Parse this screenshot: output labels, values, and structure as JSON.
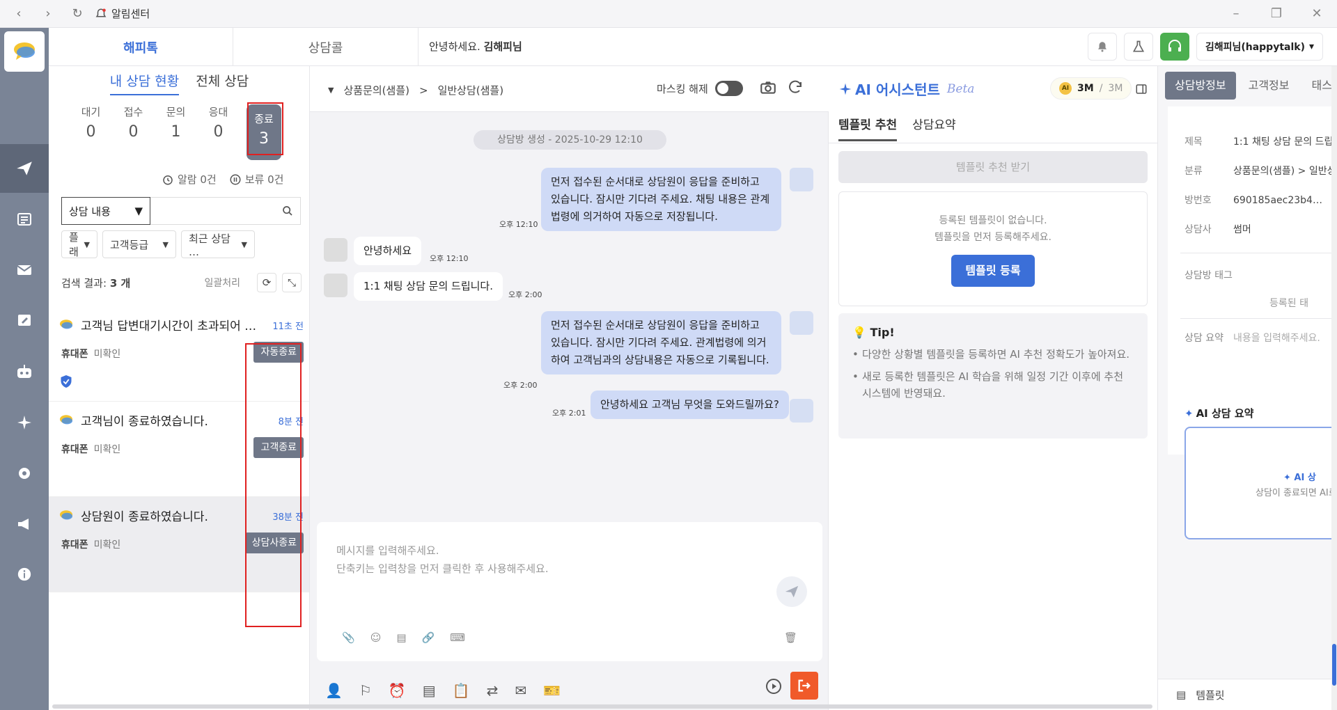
{
  "titlebar": {
    "app_name": "알림센터"
  },
  "topbar": {
    "tabs": [
      {
        "label": "해피톡"
      },
      {
        "label": "상담콜"
      }
    ],
    "greeting_prefix": "안녕하세요.",
    "greeting_name": "김해피님",
    "user_label": "김해피님(happytalk)"
  },
  "list": {
    "subtabs": [
      {
        "label": "내 상담 현황"
      },
      {
        "label": "전체 상담"
      }
    ],
    "counts": [
      {
        "label": "대기",
        "value": "0"
      },
      {
        "label": "접수",
        "value": "0"
      },
      {
        "label": "문의",
        "value": "1"
      },
      {
        "label": "응대",
        "value": "0"
      },
      {
        "label": "종료",
        "value": "3"
      }
    ],
    "alarm": "알람 0건",
    "hold": "보류 0건",
    "search_select": "상담 내용",
    "filters": [
      {
        "label": "플래"
      },
      {
        "label": "고객등급"
      },
      {
        "label": "최근 상담 …"
      }
    ],
    "result_prefix": "검색 결과:",
    "result_count": "3 개",
    "bulk_label": "일괄처리",
    "items": [
      {
        "title": "고객님 답변대기시간이 초과되어 …",
        "time": "11초 전",
        "channel": "휴대폰",
        "status": "미확인",
        "badge": "자동종료"
      },
      {
        "title": "고객님이 종료하였습니다.",
        "time": "8분 전",
        "channel": "휴대폰",
        "status": "미확인",
        "badge": "고객종료"
      },
      {
        "title": "상담원이 종료하였습니다.",
        "time": "38분 전",
        "channel": "휴대폰",
        "status": "미확인",
        "badge": "상담사종료"
      }
    ]
  },
  "chat": {
    "breadcrumb": [
      "상품문의(샘플)",
      ">",
      "일반상담(샘플)"
    ],
    "mask_label": "마스킹 해제",
    "date_pill": "상담방 생성 - 2025-10-29 12:10",
    "messages": [
      {
        "text": "먼저 접수된 순서대로 상담원이 응답을 준비하고 있습니다. 잠시만 기다려 주세요. 채팅 내용은 관계법령에 의거하여 자동으로 저장됩니다.",
        "time": "오후 12:10"
      },
      {
        "text": "안녕하세요",
        "time": "오후 12:10"
      },
      {
        "text": "1:1 채팅 상담 문의 드립니다.",
        "time": "오후 2:00"
      },
      {
        "text": "먼저 접수된 순서대로 상담원이 응답을 준비하고 있습니다. 잠시만 기다려 주세요. 관계법령에 의거하여 고객님과의 상담내용은 자동으로 기록됩니다.",
        "time": "오후 2:00"
      },
      {
        "text": "안녕하세요 고객님 무엇을 도와드릴까요?",
        "time": "오후 2:01"
      }
    ],
    "input_placeholder_1": "메시지를 입력해주세요.",
    "input_placeholder_2": "단축키는 입력창을 먼저 클릭한 후 사용해주세요."
  },
  "ai": {
    "title": "AI 어시스턴트",
    "beta": "Beta",
    "quota_used": "3M",
    "quota_sep": "/",
    "quota_total": "3M",
    "tabs": [
      {
        "label": "템플릿 추천"
      },
      {
        "label": "상담요약"
      }
    ],
    "recommend_button": "템플릿 추천 받기",
    "empty_1": "등록된 템플릿이 없습니다.",
    "empty_2": "템플릿을 먼저 등록해주세요.",
    "register_button": "템플릿 등록",
    "tip_title": "Tip!",
    "tips": [
      "다양한 상황별 템플릿을 등록하면 AI 추천 정확도가 높아져요.",
      "새로 등록한 템플릿은 AI 학습을 위해 일정 기간 이후에 추천 시스템에 반영돼요."
    ]
  },
  "info": {
    "tabs": [
      {
        "label": "상담방정보"
      },
      {
        "label": "고객정보"
      },
      {
        "label": "태스크"
      }
    ],
    "rows": [
      {
        "key": "제목",
        "value": "1:1 채팅 상담 문의 드립"
      },
      {
        "key": "분류",
        "value": "상품문의(샘플) > 일반상"
      },
      {
        "key": "방번호",
        "value": "690185aec23b4…"
      },
      {
        "key": "상담사",
        "value": "썸머"
      }
    ],
    "tag_label": "상담방 태그",
    "tag_empty": "등록된 태",
    "summary_label": "상담 요약",
    "summary_placeholder": "내용을 입력해주세요.",
    "ai_summary_title": "AI 상담 요약",
    "ai_box_title": "AI 상",
    "ai_box_text": "상담이 종료되면 AI로",
    "bottom_label": "템플릿"
  },
  "colors": {
    "accent": "#3b6fd8",
    "sidebar": "#7a8496",
    "exit": "#f05a2a",
    "agent_green": "#4caf50"
  }
}
